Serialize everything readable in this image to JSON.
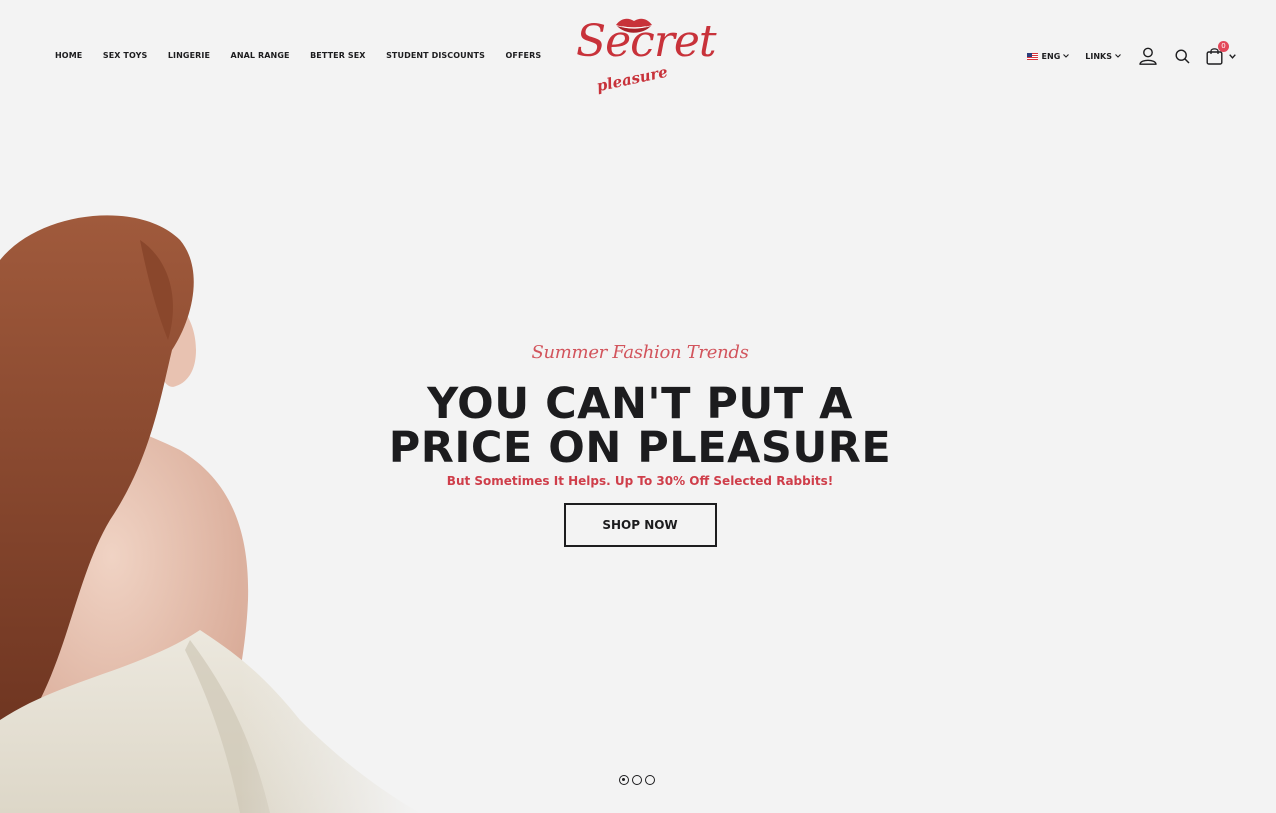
{
  "nav": {
    "items": [
      "HOME",
      "SEX TOYS",
      "LINGERIE",
      "ANAL RANGE",
      "BETTER SEX",
      "STUDENT DISCOUNTS",
      "OFFERS"
    ]
  },
  "logo": {
    "primary": "Secret",
    "secondary": "pleasure"
  },
  "tools": {
    "language": "ENG",
    "links": "LINKS",
    "cart_count": "0"
  },
  "hero": {
    "kicker": "Summer Fashion Trends",
    "headline_line1": "YOU CAN'T PUT A",
    "headline_line2": "PRICE ON PLEASURE",
    "subline": "But Sometimes It Helps. Up To 30% Off Selected Rabbits!",
    "cta": "SHOP NOW"
  },
  "slider": {
    "slide_count": 3,
    "active_index": 0
  },
  "colors": {
    "brand_red": "#c8323a",
    "accent_pink": "#d2545c",
    "text_dark": "#1c1c1e",
    "background": "#f3f3f3",
    "badge": "#e3485a"
  }
}
